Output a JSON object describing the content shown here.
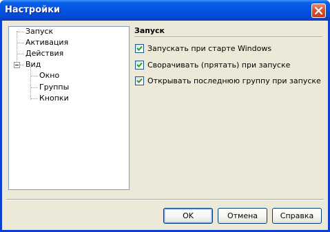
{
  "window": {
    "title": "Настройки"
  },
  "tree": {
    "items": [
      {
        "label": "Запуск"
      },
      {
        "label": "Активация"
      },
      {
        "label": "Действия"
      },
      {
        "label": "Вид"
      },
      {
        "label": "Окно"
      },
      {
        "label": "Группы"
      },
      {
        "label": "Кнопки"
      }
    ]
  },
  "panel": {
    "title": "Запуск",
    "options": [
      {
        "label": "Запускать при старте Windows",
        "checked": true
      },
      {
        "label": "Сворачивать (прятать) при запуске",
        "checked": true
      },
      {
        "label": "Открывать последнюю группу при запуске",
        "checked": true
      }
    ]
  },
  "buttons": {
    "ok": "OK",
    "cancel": "Отмена",
    "help": "Справка"
  },
  "colors": {
    "titlebar": "#0454e3",
    "face": "#ece9d8",
    "check": "#21a121"
  }
}
